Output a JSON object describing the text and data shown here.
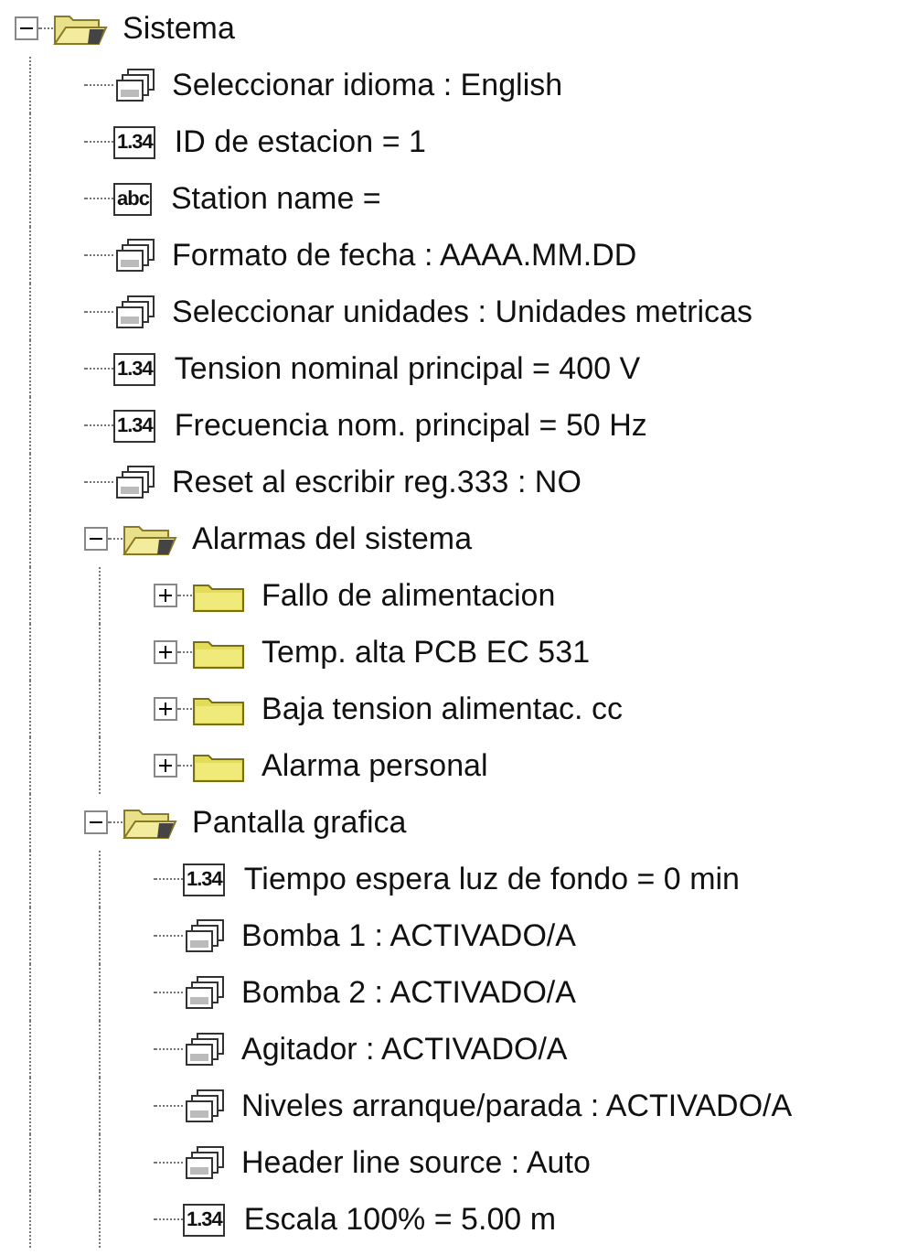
{
  "tree": [
    {
      "label": "Sistema",
      "kind": "folder",
      "expanded": true,
      "children": [
        {
          "label": "Seleccionar idioma : English",
          "kind": "list"
        },
        {
          "label": "ID de estacion = 1",
          "kind": "number",
          "icon_text": "1.34"
        },
        {
          "label": "Station name =",
          "kind": "text",
          "icon_text": "abc"
        },
        {
          "label": "Formato de fecha : AAAA.MM.DD",
          "kind": "list"
        },
        {
          "label": "Seleccionar unidades : Unidades metricas",
          "kind": "list"
        },
        {
          "label": "Tension nominal principal = 400 V",
          "kind": "number",
          "icon_text": "1.34"
        },
        {
          "label": "Frecuencia nom. principal = 50 Hz",
          "kind": "number",
          "icon_text": "1.34"
        },
        {
          "label": "Reset al escribir reg.333 : NO",
          "kind": "list"
        },
        {
          "label": "Alarmas del sistema",
          "kind": "folder",
          "expanded": true,
          "children": [
            {
              "label": "Fallo de alimentacion",
              "kind": "folder",
              "expanded": false
            },
            {
              "label": "Temp. alta PCB EC 531",
              "kind": "folder",
              "expanded": false
            },
            {
              "label": "Baja tension alimentac. cc",
              "kind": "folder",
              "expanded": false
            },
            {
              "label": "Alarma personal",
              "kind": "folder",
              "expanded": false
            }
          ]
        },
        {
          "label": "Pantalla grafica",
          "kind": "folder",
          "expanded": true,
          "children": [
            {
              "label": "Tiempo espera luz de fondo = 0 min",
              "kind": "number",
              "icon_text": "1.34"
            },
            {
              "label": "Bomba 1 : ACTIVADO/A",
              "kind": "list"
            },
            {
              "label": "Bomba 2 : ACTIVADO/A",
              "kind": "list"
            },
            {
              "label": "Agitador : ACTIVADO/A",
              "kind": "list"
            },
            {
              "label": "Niveles arranque/parada : ACTIVADO/A",
              "kind": "list"
            },
            {
              "label": "Header line source : Auto",
              "kind": "list"
            },
            {
              "label": "Escala 100% = 5.00 m",
              "kind": "number",
              "icon_text": "1.34"
            }
          ]
        }
      ]
    }
  ]
}
